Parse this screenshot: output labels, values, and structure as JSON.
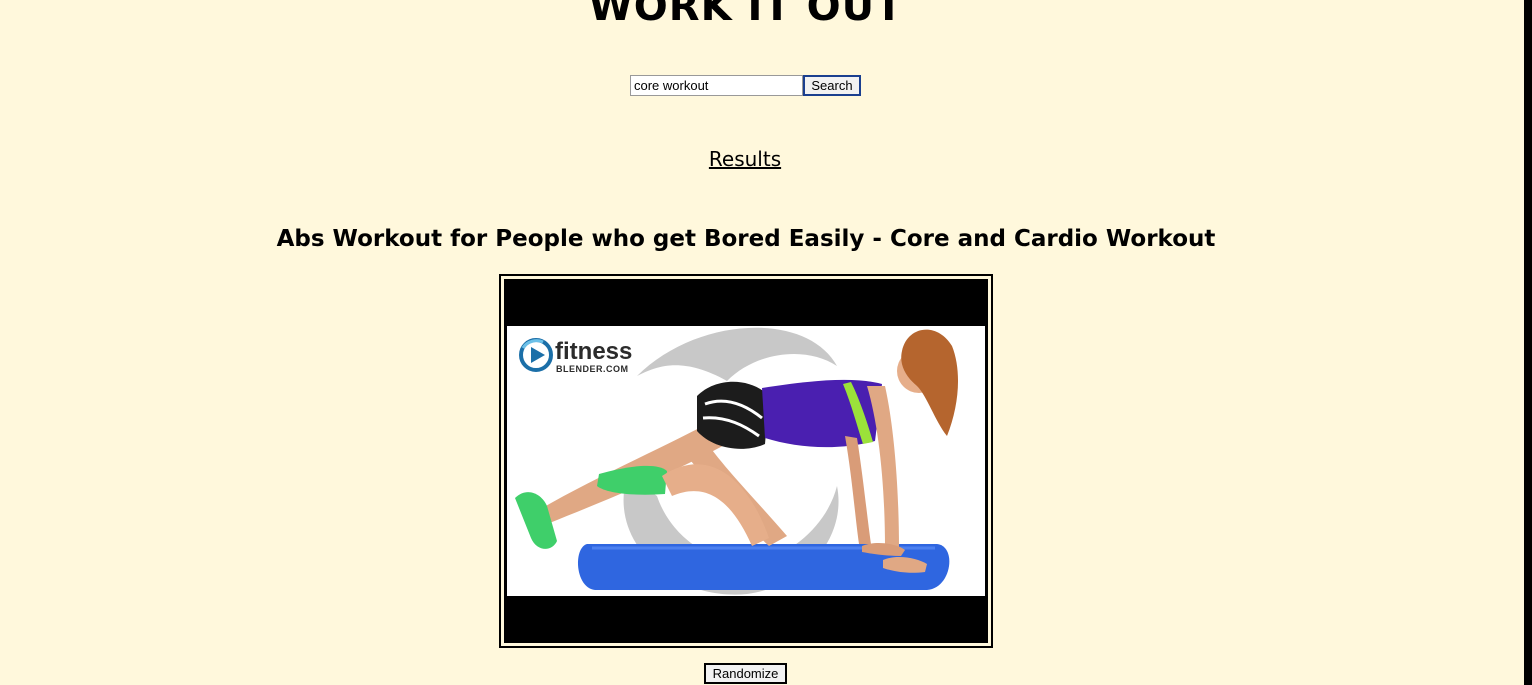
{
  "header": {
    "title": "WORK IT OUT"
  },
  "search": {
    "value": "core workout",
    "button_label": "Search"
  },
  "results": {
    "heading": "Results"
  },
  "video": {
    "title": "Abs Workout for People who get Bored Easily - Core and Cardio Workout",
    "brand_name": "fitness",
    "brand_sub": "BLENDER.COM",
    "logo_icon": "play-swirl-logo-icon"
  },
  "controls": {
    "randomize_label": "Randomize"
  },
  "colors": {
    "page_background": "#fff8dc",
    "logo_blue": "#1b6fa8",
    "mat_blue": "#2f66e0",
    "top_purple": "#4a1fb0",
    "shoe_green": "#3fcf6a"
  }
}
